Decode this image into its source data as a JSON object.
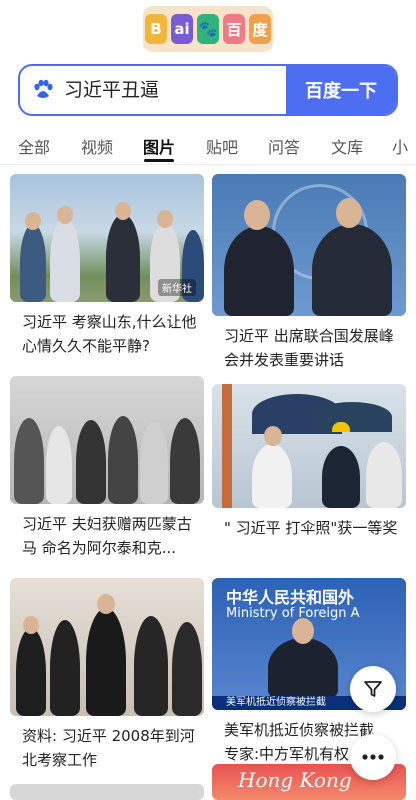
{
  "logo": {
    "letters": [
      "B",
      "ai",
      "度",
      "百",
      "度"
    ]
  },
  "search": {
    "query": "习近平丑逼",
    "button_label": "百度一下"
  },
  "tabs": [
    {
      "label": "全部"
    },
    {
      "label": "视频"
    },
    {
      "label": "图片",
      "active": true
    },
    {
      "label": "贴吧"
    },
    {
      "label": "问答"
    },
    {
      "label": "文库"
    },
    {
      "label": "小"
    }
  ],
  "results": [
    {
      "caption": "习近平 考察山东,什么让他心情久久不能平静?",
      "badge": "新华社"
    },
    {
      "caption": "习近平 出席联合国发展峰会并发表重要讲话"
    },
    {
      "caption": "习近平 夫妇获赠两匹蒙古马 命名为阿尔泰和克..."
    },
    {
      "caption": "\" 习近平 打伞照\"获一等奖"
    },
    {
      "caption": "资料: 习近平 2008年到河北考察工作"
    },
    {
      "caption": "美军机抵近侦察被拦截 专家:中方军机有权 逼 离",
      "banner_top": "中华人民共和国外",
      "banner_sub": "Ministry of Foreign A",
      "ticker": "美军机抵近侦察被拦截"
    },
    {
      "caption": "",
      "banner_top": "Hong Kong"
    }
  ],
  "fab": {
    "filter_icon": "filter-icon",
    "more_icon": "more-icon"
  }
}
